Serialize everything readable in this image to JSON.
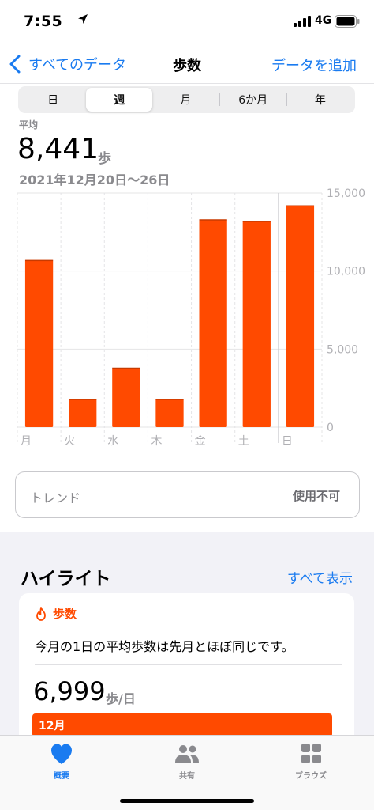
{
  "status": {
    "time": "7:55",
    "network": "4G",
    "location_icon": "location-arrow-icon",
    "signal_icon": "signal-bars-icon",
    "battery_icon": "battery-icon"
  },
  "nav": {
    "back_label": "すべてのデータ",
    "title": "歩数",
    "action_label": "データを追加"
  },
  "segments": [
    "日",
    "週",
    "月",
    "6か月",
    "年"
  ],
  "selected_segment": "週",
  "summary": {
    "avg_label": "平均",
    "avg_value": "8,441",
    "avg_unit": "歩",
    "date_range": "2021年12月20日〜26日"
  },
  "chart_data": {
    "type": "bar",
    "categories": [
      "月",
      "火",
      "水",
      "木",
      "金",
      "土",
      "日"
    ],
    "values": [
      10700,
      1800,
      3800,
      1800,
      13300,
      13200,
      14200
    ],
    "ylim": [
      0,
      15000
    ],
    "yticks": [
      0,
      5000,
      10000,
      15000
    ],
    "ytick_labels": [
      "0",
      "5,000",
      "10,000",
      "15,000"
    ],
    "grid": true,
    "bar_color": "#ff4a00"
  },
  "trend": {
    "label": "トレンド",
    "status": "使用不可"
  },
  "highlights": {
    "title": "ハイライト",
    "show_all": "すべて表示",
    "card": {
      "category": "歩数",
      "category_icon": "flame-icon",
      "description": "今月の1日の平均歩数は先月とほぼ同じです。",
      "value": "6,999",
      "unit": "歩/日",
      "bar_label": "12月"
    }
  },
  "tabs": [
    {
      "label": "概要",
      "icon": "heart-icon",
      "active": true
    },
    {
      "label": "共有",
      "icon": "people-icon",
      "active": false
    },
    {
      "label": "ブラウズ",
      "icon": "grid-icon",
      "active": false
    }
  ],
  "colors": {
    "accent": "#1a7bf0",
    "steps": "#ff4a00",
    "inactive": "#8a8a8e"
  }
}
